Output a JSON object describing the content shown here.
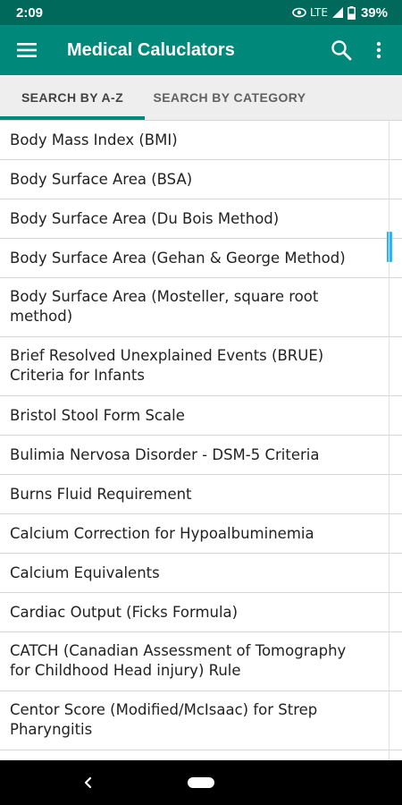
{
  "status_bar": {
    "time": "2:09",
    "network": "LTE",
    "battery": "39%",
    "icons": [
      "eye-icon",
      "signal-icon",
      "battery-icon"
    ]
  },
  "app_bar": {
    "title": "Medical Caluclators",
    "icons": [
      "menu-icon",
      "search-icon",
      "more-vert-icon"
    ]
  },
  "tabs": [
    {
      "label": "SEARCH BY A-Z",
      "active": true
    },
    {
      "label": "SEARCH BY CATEGORY",
      "active": false
    }
  ],
  "list_items": [
    "Body Mass Index (BMI)",
    "Body Surface Area (BSA)",
    "Body Surface Area (Du Bois Method)",
    "Body Surface Area (Gehan & George Method)",
    "Body Surface Area (Mosteller, square root method)",
    "Brief Resolved Unexplained Events (BRUE) Criteria for Infants",
    "Bristol Stool Form Scale",
    "Bulimia Nervosa Disorder - DSM-5 Criteria",
    "Burns Fluid Requirement",
    "Calcium Correction for Hypoalbuminemia",
    "Calcium Equivalents",
    "Cardiac Output (Ficks Formula)",
    "CATCH (Canadian Assessment of Tomography for Childhood Head injury) Rule",
    "Centor Score (Modified/McIsaac) for Strep Pharyngitis"
  ],
  "colors": {
    "status_bar": "#00695c",
    "app_bar": "#00897b",
    "tab_indicator": "#00897b",
    "scroll_thumb": "#29b6f6"
  }
}
